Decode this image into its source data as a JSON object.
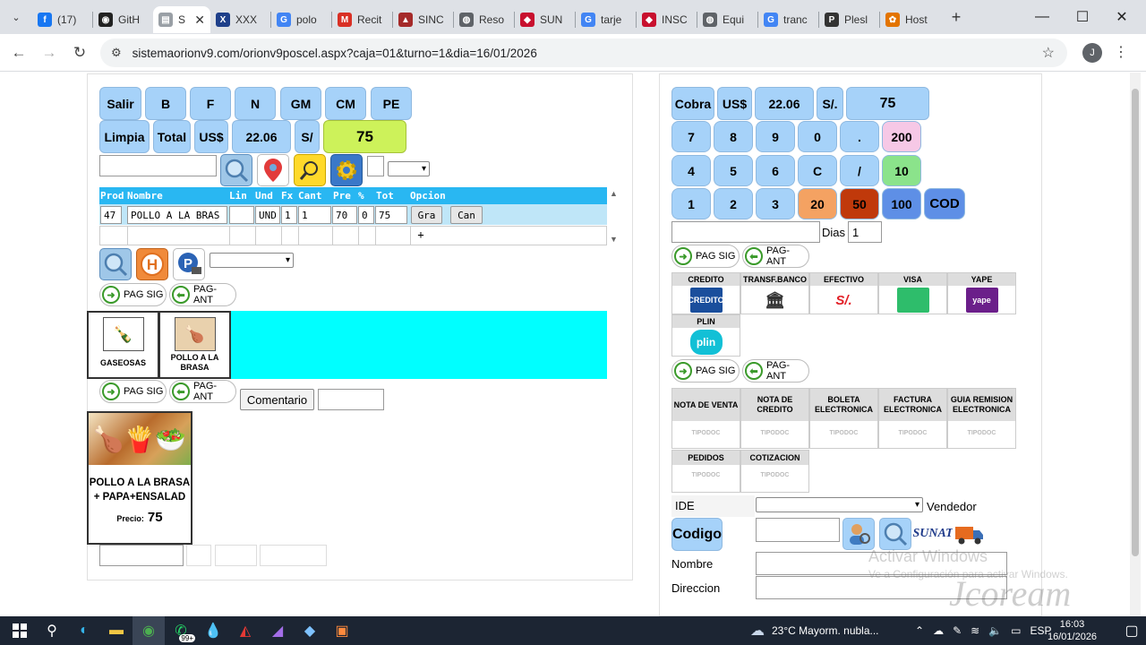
{
  "browser": {
    "tabs": [
      {
        "label": "(17)",
        "icon": "facebook-icon",
        "color": "#1877f2",
        "glyph": "f"
      },
      {
        "label": "GitH",
        "icon": "github-icon",
        "color": "#222222",
        "glyph": "◉"
      },
      {
        "label": "S",
        "icon": "document-icon",
        "color": "#9aa0a6",
        "glyph": "▤",
        "active": true
      },
      {
        "label": "XXX",
        "icon": "x-icon",
        "color": "#1e3f8a",
        "glyph": "X"
      },
      {
        "label": "polo",
        "icon": "google-icon",
        "color": "#4285f4",
        "glyph": "G"
      },
      {
        "label": "Recit",
        "icon": "gmail-icon",
        "color": "#d93025",
        "glyph": "M"
      },
      {
        "label": "SINC",
        "icon": "sinc-icon",
        "color": "#a52a2a",
        "glyph": "▲"
      },
      {
        "label": "Reso",
        "icon": "globe-icon",
        "color": "#5f6368",
        "glyph": "◍"
      },
      {
        "label": "SUN",
        "icon": "sunat-icon",
        "color": "#c8102e",
        "glyph": "◆"
      },
      {
        "label": "tarje",
        "icon": "google-icon",
        "color": "#4285f4",
        "glyph": "G"
      },
      {
        "label": "INSC",
        "icon": "sunat-icon",
        "color": "#c8102e",
        "glyph": "◆"
      },
      {
        "label": "Equi",
        "icon": "globe-icon",
        "color": "#5f6368",
        "glyph": "◍"
      },
      {
        "label": "tranc",
        "icon": "google-icon",
        "color": "#4285f4",
        "glyph": "G"
      },
      {
        "label": "Plesl",
        "icon": "plesk-icon",
        "color": "#333333",
        "glyph": "P"
      },
      {
        "label": "Host",
        "icon": "host-icon",
        "color": "#e37400",
        "glyph": "✿"
      }
    ],
    "url": "sistemaorionv9.com/orionv9poscel.aspx?caja=01&turno=1&dia=16/01/2026",
    "profile_initial": "J"
  },
  "left": {
    "row1": [
      "Salir",
      "B",
      "F",
      "N",
      "GM",
      "CM",
      "PE"
    ],
    "row2": {
      "limpia": "Limpia",
      "total": "Total",
      "currency": "US$",
      "rate": "22.06",
      "soles": "S/",
      "amount": "75"
    },
    "grid": {
      "headers": [
        "Prod",
        "Nombre",
        "Lin",
        "Und",
        "Fx",
        "Cant",
        "Pre",
        "%",
        "Tot",
        "Opcion"
      ],
      "row": {
        "prod": "47",
        "nombre": "POLLO A LA BRAS",
        "lin": "",
        "und": "UND",
        "fx": "1",
        "cant": "1",
        "pre": "70",
        "pct": "0",
        "tot": "75",
        "gra": "Gra",
        "can": "Can"
      },
      "add": "+"
    },
    "paging": {
      "next": "PAG SIG",
      "prev": "PAG-ANT"
    },
    "categories": [
      {
        "label": "GASEOSAS"
      },
      {
        "label": "POLLO A LA BRASA"
      }
    ],
    "comment_button": "Comentario",
    "product": {
      "name": "POLLO A LA BRASA + PAPA+ENSALAD",
      "price_label": "Precio:",
      "price": "75"
    }
  },
  "right": {
    "row1": {
      "cobra": "Cobra",
      "currency": "US$",
      "rate": "22.06",
      "soles": "S/.",
      "amount": "75"
    },
    "keypad": [
      [
        "7",
        "8",
        "9",
        "0",
        ".",
        "200"
      ],
      [
        "4",
        "5",
        "6",
        "C",
        "/",
        "10"
      ],
      [
        "1",
        "2",
        "3",
        "20",
        "50",
        "100",
        "COD"
      ]
    ],
    "dias_label": "Dias",
    "dias_value": "1",
    "payments": [
      {
        "label": "CREDITO",
        "logo": "CREDITO",
        "color": "#1a4e9c"
      },
      {
        "label": "TRANSF.BANCO",
        "logo": "🏛",
        "color": "#ffffff"
      },
      {
        "label": "EFECTIVO",
        "logo": "S/.",
        "color": "#ffffff"
      },
      {
        "label": "VISA",
        "logo": "",
        "color": "#2ebd6b"
      },
      {
        "label": "YAPE",
        "logo": "yape",
        "color": "#6b1f8a"
      },
      {
        "label": "PLIN",
        "logo": "plin",
        "color": "#12c0d6"
      }
    ],
    "documents": [
      {
        "label": "NOTA DE VENTA",
        "tag": "TIPODOC"
      },
      {
        "label": "NOTA DE CREDITO",
        "tag": "TIPODOC"
      },
      {
        "label": "BOLETA ELECTRONICA",
        "tag": "TIPODOC"
      },
      {
        "label": "FACTURA ELECTRONICA",
        "tag": "TIPODOC"
      },
      {
        "label": "GUIA REMISION ELECTRONICA",
        "tag": "TIPODOC"
      },
      {
        "label": "PEDIDOS",
        "tag": "TIPODOC"
      },
      {
        "label": "COTIZACION",
        "tag": "TIPODOC"
      }
    ],
    "ide_label": "IDE",
    "vendedor_label": "Vendedor",
    "codigo_button": "Codigo",
    "nombre_label": "Nombre",
    "direccion_label": "Direccion",
    "sunat_label": "SUNAT"
  },
  "watermark": {
    "line1": "Activar Windows",
    "line2": "Ve a Configuración para activar Windows.",
    "brand": "Jcoream"
  },
  "taskbar": {
    "weather": "23°C  Mayorm. nubla...",
    "lang": "ESP",
    "time": "16:03",
    "date": "16/01/2026",
    "badge": "99+"
  }
}
